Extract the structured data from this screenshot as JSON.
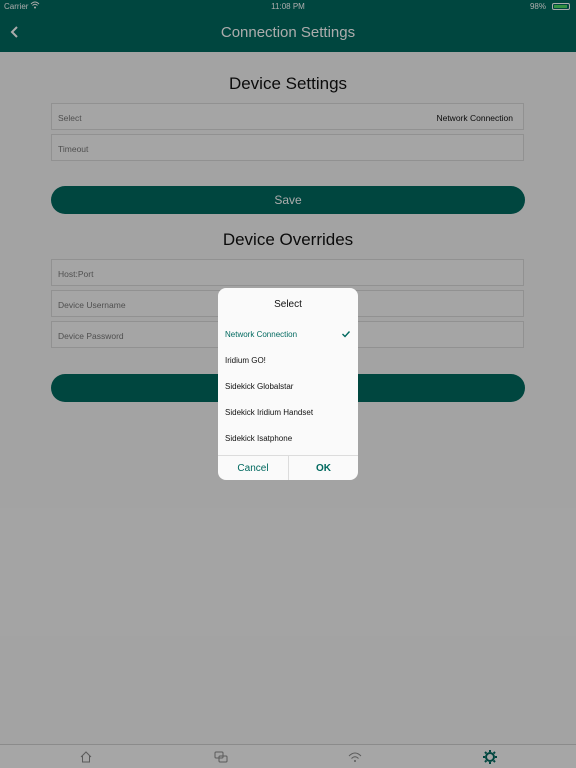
{
  "status_bar": {
    "carrier": "Carrier",
    "time": "11:08 PM",
    "battery": "98%"
  },
  "nav": {
    "title": "Connection Settings"
  },
  "device_settings": {
    "title": "Device Settings",
    "select_label": "Select",
    "select_value": "Network Connection",
    "timeout_label": "Timeout",
    "save_label": "Save"
  },
  "device_overrides": {
    "title": "Device Overrides",
    "host_port_label": "Host:Port",
    "username_label": "Device Username",
    "password_label": "Device Password"
  },
  "dialog": {
    "title": "Select",
    "options": [
      {
        "label": "Network Connection",
        "selected": true
      },
      {
        "label": "Iridium GO!",
        "selected": false
      },
      {
        "label": "Sidekick Globalstar",
        "selected": false
      },
      {
        "label": "Sidekick Iridium Handset",
        "selected": false
      },
      {
        "label": "Sidekick Isatphone",
        "selected": false
      }
    ],
    "cancel_label": "Cancel",
    "ok_label": "OK"
  },
  "tabbar": {
    "tabs": [
      {
        "icon": "home-icon"
      },
      {
        "icon": "chat-icon"
      },
      {
        "icon": "wifi-icon"
      },
      {
        "icon": "gear-icon",
        "active": true
      }
    ]
  },
  "colors": {
    "accent": "#00695f",
    "overlay": "rgba(0,0,0,0.33)"
  }
}
